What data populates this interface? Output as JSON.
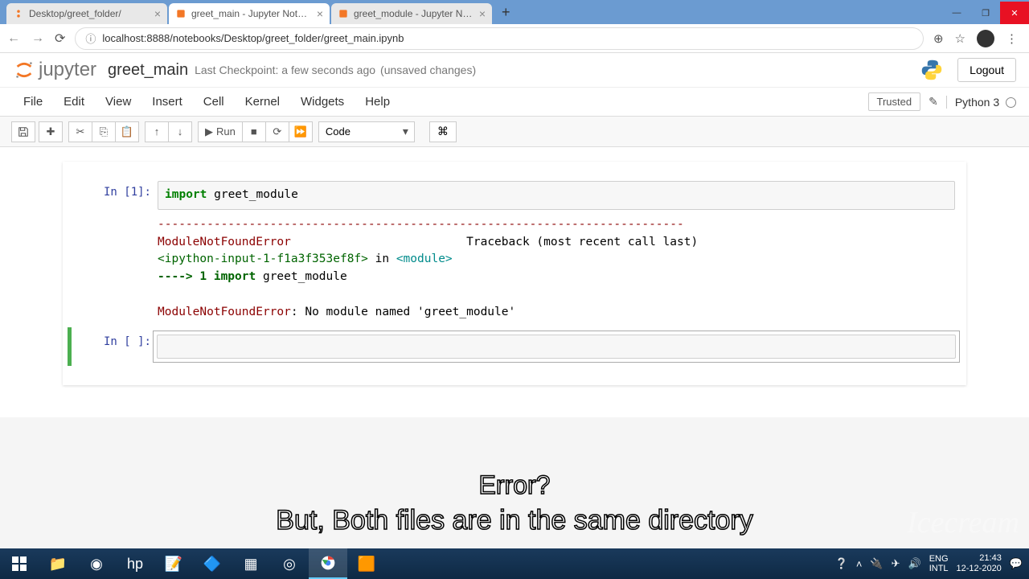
{
  "browser": {
    "tabs": [
      {
        "title": "Desktop/greet_folder/",
        "active": false
      },
      {
        "title": "greet_main - Jupyter Notebook",
        "active": true
      },
      {
        "title": "greet_module - Jupyter Notebook",
        "active": false
      }
    ],
    "url": "localhost:8888/notebooks/Desktop/greet_folder/greet_main.ipynb"
  },
  "jupyter": {
    "logo_text": "jupyter",
    "notebook_name": "greet_main",
    "checkpoint_prefix": "Last Checkpoint: ",
    "checkpoint_time": "a few seconds ago",
    "unsaved": "(unsaved changes)",
    "logout": "Logout",
    "menu": [
      "File",
      "Edit",
      "View",
      "Insert",
      "Cell",
      "Kernel",
      "Widgets",
      "Help"
    ],
    "trusted": "Trusted",
    "kernel": "Python 3",
    "toolbar": {
      "run": "Run",
      "cell_type": "Code"
    }
  },
  "cells": {
    "in1_prompt": "In [1]:",
    "in1_code_kw": "import",
    "in1_code_rest": " greet_module",
    "sep": "---------------------------------------------------------------------------",
    "err_name": "ModuleNotFoundError",
    "traceback_hdr": "Traceback (most recent call last)",
    "frame_loc": "<ipython-input-1-f1a3f353ef8f>",
    "frame_in": " in ",
    "frame_mod": "<module>",
    "arrow": "----> 1 ",
    "arrow_kw": "import",
    "arrow_rest": " greet_module",
    "final_err": "ModuleNotFoundError",
    "final_msg": ": No module named 'greet_module'",
    "in_empty_prompt": "In [ ]:"
  },
  "overlay": {
    "line1": "Error?",
    "line2": "But, Both files are in the same directory",
    "watermark": "Icecream"
  },
  "taskbar": {
    "lang1": "ENG",
    "lang2": "INTL",
    "time": "21:43",
    "date": "12-12-2020"
  }
}
